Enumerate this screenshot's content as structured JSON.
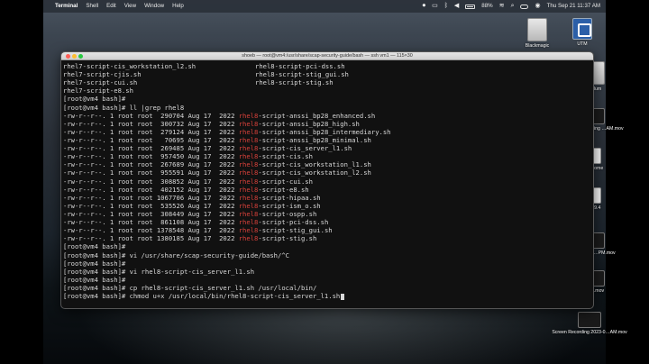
{
  "menubar": {
    "app_name": "Terminal",
    "menus": [
      "Shell",
      "Edit",
      "View",
      "Window",
      "Help"
    ],
    "battery": "88%",
    "datetime": "Thu Sep 21  11:37 AM"
  },
  "desktop": {
    "icons": [
      {
        "label": "Blackmagic",
        "icon": "drive-icon"
      },
      {
        "label": "UTM",
        "icon": "utm-app-icon"
      },
      {
        "label": "Volum",
        "icon": "drive-icon"
      },
      {
        "label": "Screen Recording …AM.mov",
        "icon": "video-file-icon"
      },
      {
        "label": "Chrome",
        "icon": "document-icon"
      },
      {
        "label": "ol 9.4",
        "icon": "document-icon"
      },
      {
        "label": "Recording …PM.mov",
        "icon": "video-file-icon"
      },
      {
        "label": "…PM.mov",
        "icon": "video-file-icon"
      },
      {
        "label": "Screen Recording 2023-0…AM.mov",
        "icon": "video-file-icon"
      }
    ]
  },
  "terminal": {
    "title": "shoeb — root@vm4:/usr/share/scap-security-guide/bash — ssh vm1 — 115×30",
    "grep_highlight": "rhel8",
    "lines": [
      {
        "a": "rhel7-script-cis_workstation_l2.sh",
        "b": "rhel8-script-pci-dss.sh"
      },
      {
        "a": "rhel7-script-cjis.sh",
        "b": "rhel8-script-stig_gui.sh"
      },
      {
        "a": "rhel7-script-cui.sh",
        "b": "rhel8-script-stig.sh"
      },
      {
        "a": "rhel7-script-e8.sh",
        "b": ""
      },
      {
        "text": "[root@vm4 bash]#"
      },
      {
        "text": "[root@vm4 bash]# ll |grep rhel8"
      },
      {
        "p": "-rw-r--r--. 1 root root  290704 Aug 17  2022 ",
        "m": "rhel8",
        "s": "-script-anssi_bp28_enhanced.sh"
      },
      {
        "p": "-rw-r--r--. 1 root root  300732 Aug 17  2022 ",
        "m": "rhel8",
        "s": "-script-anssi_bp28_high.sh"
      },
      {
        "p": "-rw-r--r--. 1 root root  279124 Aug 17  2022 ",
        "m": "rhel8",
        "s": "-script-anssi_bp28_intermediary.sh"
      },
      {
        "p": "-rw-r--r--. 1 root root   70695 Aug 17  2022 ",
        "m": "rhel8",
        "s": "-script-anssi_bp28_minimal.sh"
      },
      {
        "p": "-rw-r--r--. 1 root root  269485 Aug 17  2022 ",
        "m": "rhel8",
        "s": "-script-cis_server_l1.sh"
      },
      {
        "p": "-rw-r--r--. 1 root root  957450 Aug 17  2022 ",
        "m": "rhel8",
        "s": "-script-cis.sh"
      },
      {
        "p": "-rw-r--r--. 1 root root  267689 Aug 17  2022 ",
        "m": "rhel8",
        "s": "-script-cis_workstation_l1.sh"
      },
      {
        "p": "-rw-r--r--. 1 root root  955591 Aug 17  2022 ",
        "m": "rhel8",
        "s": "-script-cis_workstation_l2.sh"
      },
      {
        "p": "-rw-r--r--. 1 root root  308852 Aug 17  2022 ",
        "m": "rhel8",
        "s": "-script-cui.sh"
      },
      {
        "p": "-rw-r--r--. 1 root root  402152 Aug 17  2022 ",
        "m": "rhel8",
        "s": "-script-e8.sh"
      },
      {
        "p": "-rw-r--r--. 1 root root 1067706 Aug 17  2022 ",
        "m": "rhel8",
        "s": "-script-hipaa.sh"
      },
      {
        "p": "-rw-r--r--. 1 root root  535526 Aug 17  2022 ",
        "m": "rhel8",
        "s": "-script-ism_o.sh"
      },
      {
        "p": "-rw-r--r--. 1 root root  308449 Aug 17  2022 ",
        "m": "rhel8",
        "s": "-script-ospp.sh"
      },
      {
        "p": "-rw-r--r--. 1 root root  861108 Aug 17  2022 ",
        "m": "rhel8",
        "s": "-script-pci-dss.sh"
      },
      {
        "p": "-rw-r--r--. 1 root root 1378548 Aug 17  2022 ",
        "m": "rhel8",
        "s": "-script-stig_gui.sh"
      },
      {
        "p": "-rw-r--r--. 1 root root 1380185 Aug 17  2022 ",
        "m": "rhel8",
        "s": "-script-stig.sh"
      },
      {
        "text": "[root@vm4 bash]#"
      },
      {
        "text": "[root@vm4 bash]# vi /usr/share/scap-security-guide/bash/^C"
      },
      {
        "text": "[root@vm4 bash]#"
      },
      {
        "text": "[root@vm4 bash]# vi rhel8-script-cis_server_l1.sh"
      },
      {
        "text": "[root@vm4 bash]#"
      },
      {
        "text": "[root@vm4 bash]# cp rhel8-script-cis_server_l1.sh /usr/local/bin/"
      },
      {
        "text": "[root@vm4 bash]# chmod u+x /usr/local/bin/rhel8-script-cis_server_l1.sh",
        "cursor": true
      }
    ]
  }
}
